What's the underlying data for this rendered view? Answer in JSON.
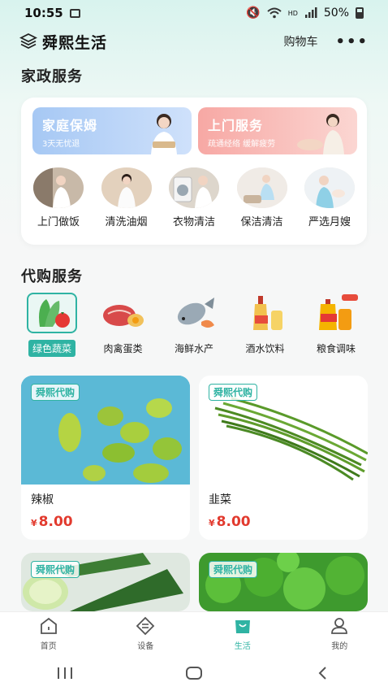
{
  "status": {
    "time": "10:55",
    "battery": "50%",
    "net": "HD"
  },
  "header": {
    "title": "舜熙生活",
    "cart": "购物车"
  },
  "home_services": {
    "title": "家政服务",
    "banners": [
      {
        "title": "家庭保姆",
        "sub": "3天无忧退"
      },
      {
        "title": "上门服务",
        "sub": "疏通经络 缓解疲劳"
      }
    ],
    "items": [
      {
        "label": "上门做饭"
      },
      {
        "label": "清洗油烟"
      },
      {
        "label": "衣物清洁"
      },
      {
        "label": "保洁清洁"
      },
      {
        "label": "严选月嫂"
      }
    ]
  },
  "purchase": {
    "title": "代购服务",
    "categories": [
      {
        "label": "绿色蔬菜"
      },
      {
        "label": "肉禽蛋类"
      },
      {
        "label": "海鲜水产"
      },
      {
        "label": "酒水饮料"
      },
      {
        "label": "粮食调味"
      }
    ]
  },
  "products": [
    {
      "tag": "舜熙代购",
      "name": "辣椒",
      "currency": "¥",
      "price": "8.00"
    },
    {
      "tag": "舜熙代购",
      "name": "韭菜",
      "currency": "¥",
      "price": "8.00"
    },
    {
      "tag": "舜熙代购"
    },
    {
      "tag": "舜熙代购"
    }
  ],
  "tabs": [
    {
      "label": "首页"
    },
    {
      "label": "设备"
    },
    {
      "label": "生活"
    },
    {
      "label": "我的"
    }
  ],
  "colors": {
    "accent": "#2fb3a3",
    "price": "#e23a2e"
  }
}
